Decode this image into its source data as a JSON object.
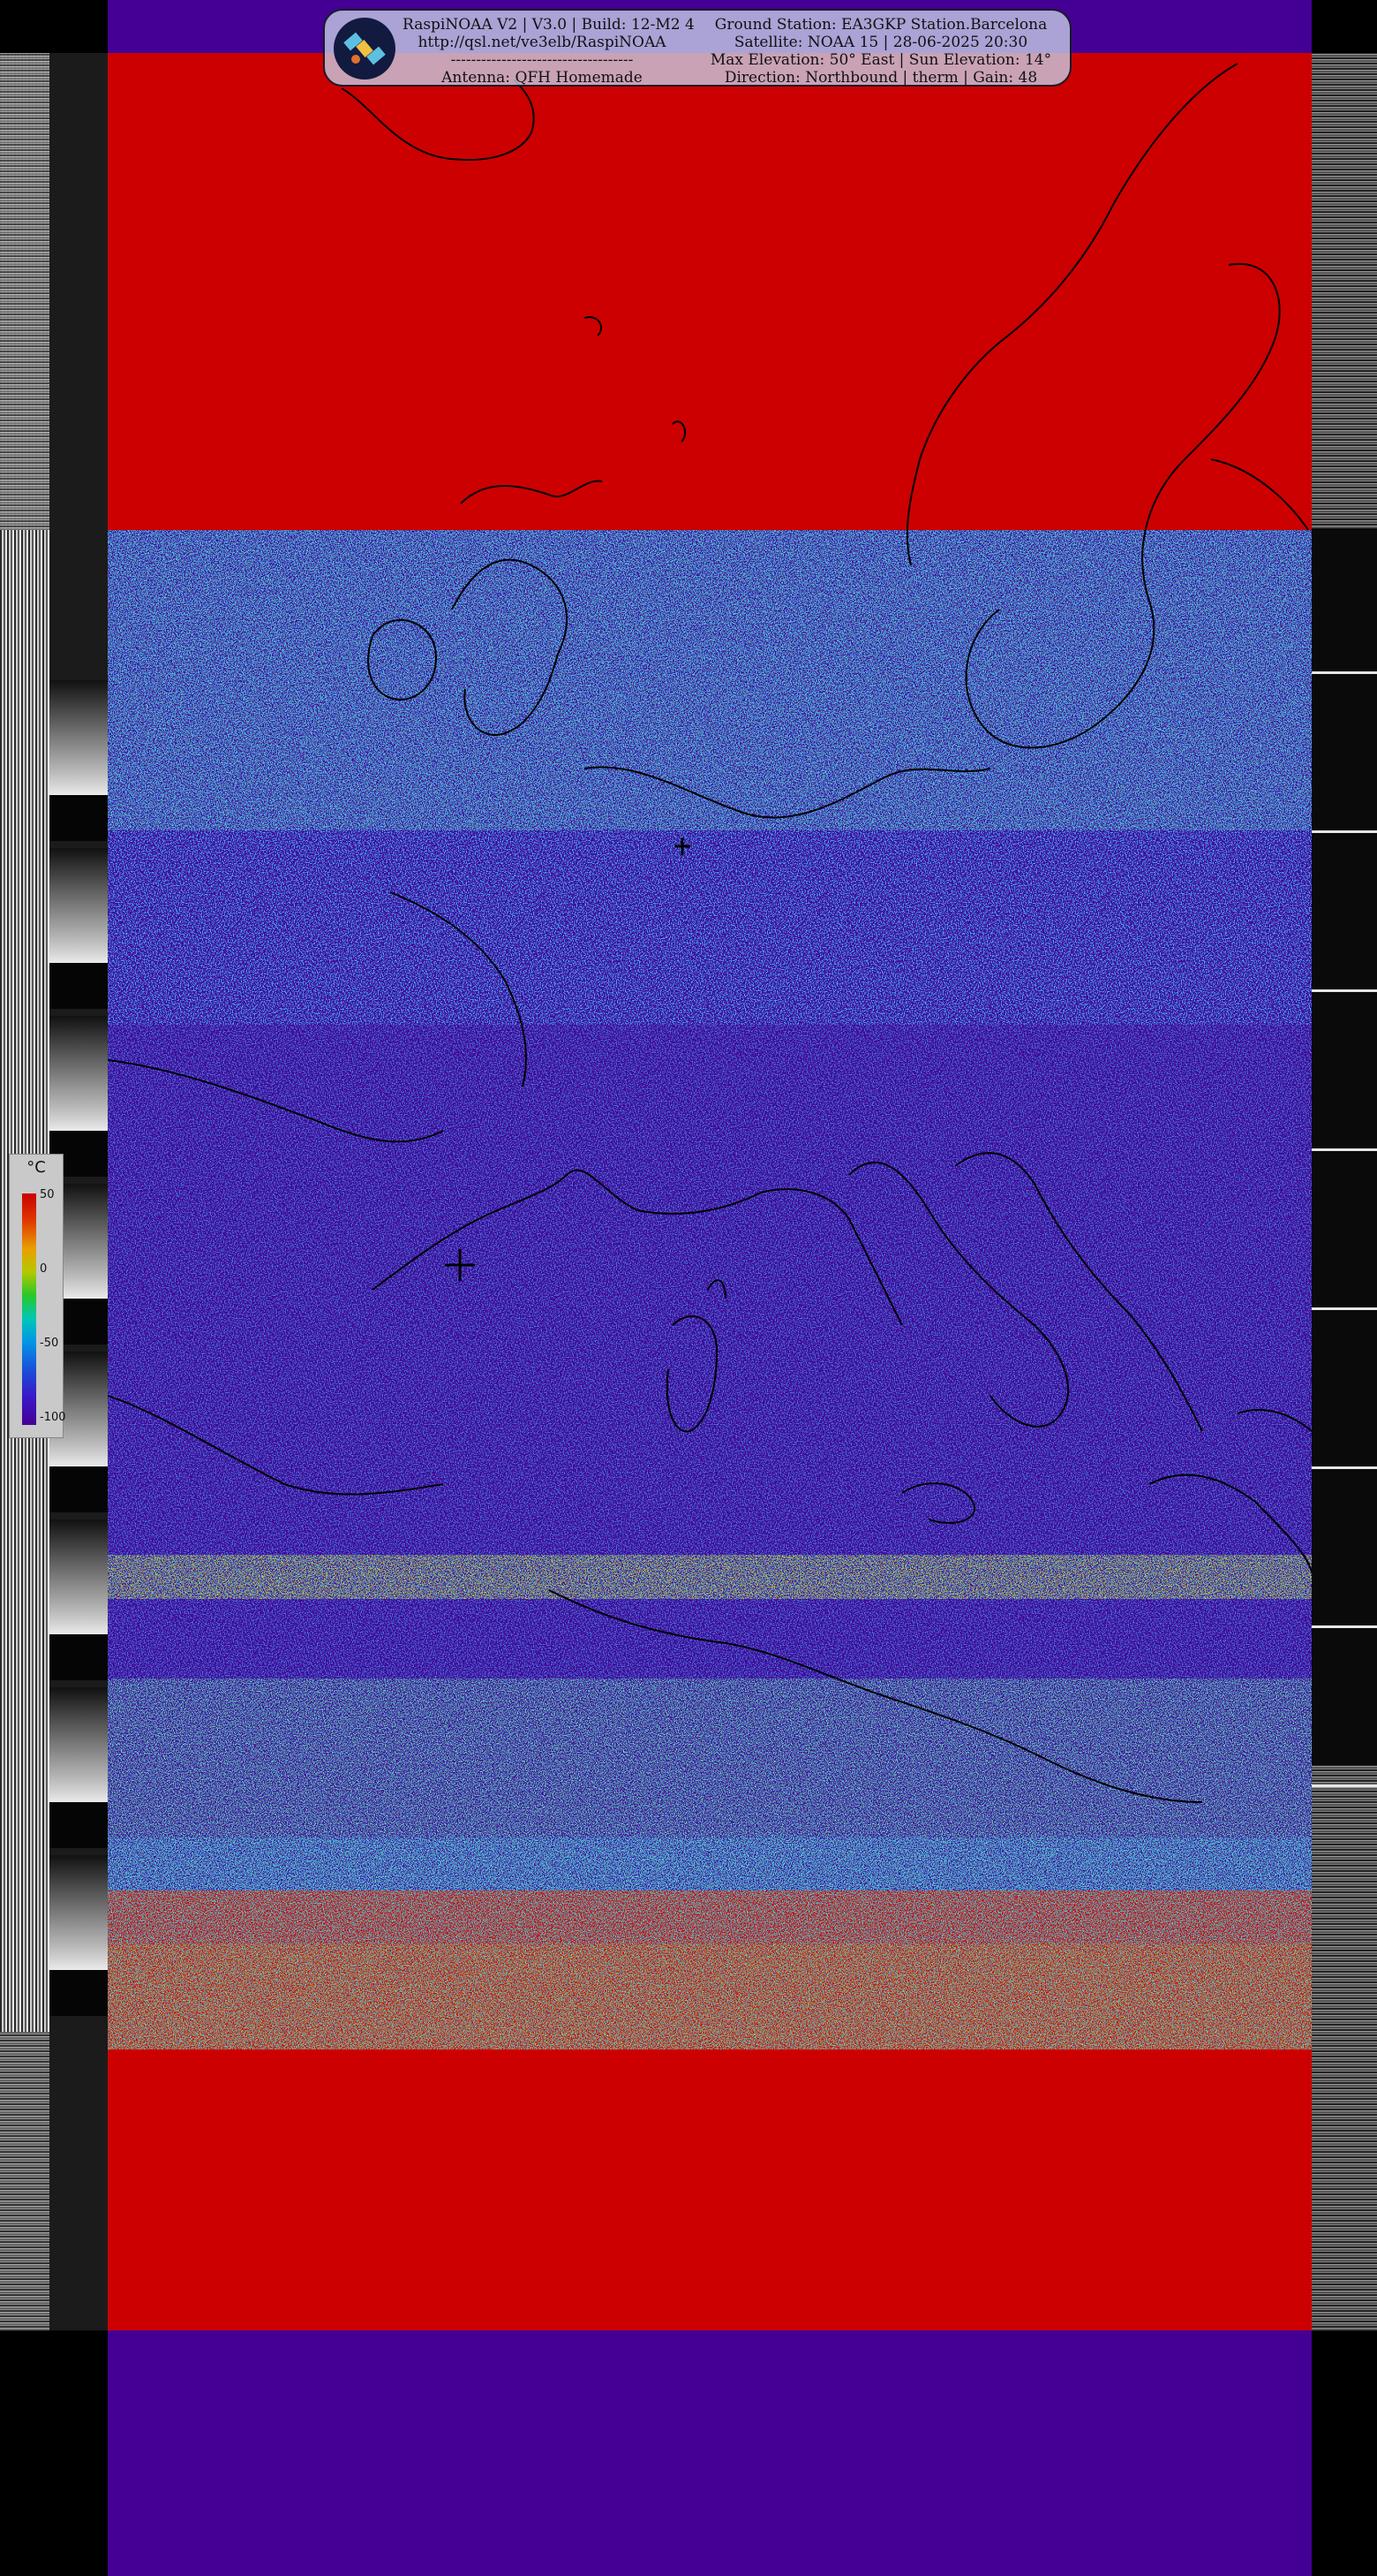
{
  "header": {
    "left_lines": [
      "RaspiNOAA V2 | V3.0 | Build: 12-M2 4",
      "http://qsl.net/ve3elb/RaspiNOAA",
      "------------------------------------",
      "Antenna: QFH Homemade"
    ],
    "right_lines": [
      "Ground Station: EA3GKP Station.Barcelona",
      "Satellite: NOAA 15 | 28-06-2025 20:30",
      "Max Elevation: 50° East | Sun Elevation: 14°",
      "Direction: Northbound | therm | Gain: 48"
    ],
    "logo_icon": "satellite-icon"
  },
  "legend": {
    "title": "°C",
    "ticks": [
      "50",
      "0",
      "-50",
      "-100"
    ],
    "colors": [
      "#c80000",
      "#e8a000",
      "#28c828",
      "#00c8b4",
      "#1850d8",
      "#440094"
    ]
  },
  "image": {
    "palette": {
      "warm": "#cc0000",
      "cold": "#440094",
      "coastline": "#000000"
    },
    "markers": [
      "crosshair-icon",
      "crosshair-icon"
    ]
  }
}
